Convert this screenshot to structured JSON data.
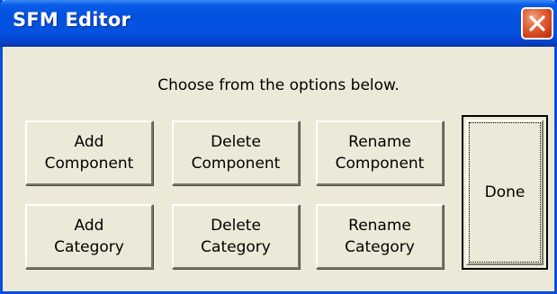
{
  "window": {
    "title": "SFM Editor",
    "close_icon": "close-icon"
  },
  "colors": {
    "titlebar": "#0552e0",
    "window_border": "#0a4fd8",
    "client_background": "#ece9d8",
    "close_button": "#cd3d16"
  },
  "instructions": "Choose from the options below.",
  "buttons": {
    "add_component": {
      "line1": "Add",
      "line2": "Component"
    },
    "delete_component": {
      "line1": "Delete",
      "line2": "Component"
    },
    "rename_component": {
      "line1": "Rename",
      "line2": "Component"
    },
    "add_category": {
      "line1": "Add",
      "line2": "Category"
    },
    "delete_category": {
      "line1": "Delete",
      "line2": "Category"
    },
    "rename_category": {
      "line1": "Rename",
      "line2": "Category"
    },
    "done": "Done"
  }
}
